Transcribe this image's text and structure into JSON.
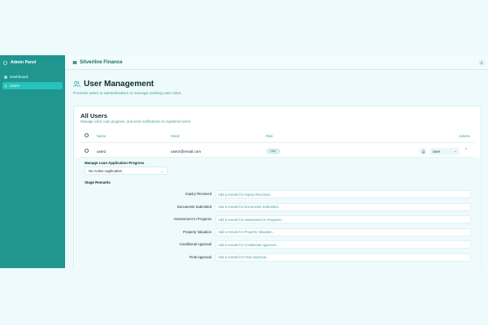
{
  "sidebar": {
    "title": "Admin Panel",
    "items": [
      {
        "label": "Dashboard",
        "icon": "grid-icon",
        "active": false
      },
      {
        "label": "Users",
        "icon": "user-icon",
        "active": true
      }
    ]
  },
  "topbar": {
    "brand": "Silverline Finance",
    "avatar_text": "S"
  },
  "page": {
    "title": "User Management",
    "subtitle": "Promote users to administrators or manage existing user roles."
  },
  "card": {
    "title": "All Users",
    "subtitle": "Manage roles, loan progress, and send notifications to registered users.",
    "columns": {
      "name": "Name",
      "email": "Email",
      "role": "Role",
      "actions": "Actions"
    },
    "row": {
      "name": "user2",
      "email": "user2@email.com",
      "role_badge": "User",
      "role_select": "User"
    },
    "detail": {
      "progress_label": "Manage Loan Application Progress",
      "application_select": "No Active Application",
      "remarks_label": "Stage Remarks",
      "stages": [
        {
          "label": "Inquiry Received",
          "placeholder": "Add a remark for Inquiry Received..."
        },
        {
          "label": "Documents Submitted",
          "placeholder": "Add a remark for Documents Submitted..."
        },
        {
          "label": "Assessment In Progress",
          "placeholder": "Add a remark for Assessment In Progress..."
        },
        {
          "label": "Property Valuation",
          "placeholder": "Add a remark for Property Valuation..."
        },
        {
          "label": "Conditional Approval",
          "placeholder": "Add a remark for Conditional Approval..."
        },
        {
          "label": "Final Approval",
          "placeholder": "Add a remark for Final Approval..."
        }
      ]
    }
  },
  "colors": {
    "sidebar": "#1f9690",
    "accent": "#27c2ba",
    "muted_text": "#3f9e99"
  }
}
